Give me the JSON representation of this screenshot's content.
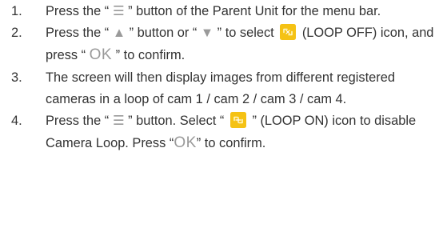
{
  "steps": [
    {
      "number": "1.",
      "parts": [
        "Press the “ ",
        "☰",
        " ” button of the Parent Unit for the menu bar."
      ]
    },
    {
      "number": "2.",
      "parts": [
        "Press the “ ",
        "▲",
        " ” button or “ ",
        "▼",
        " ” to select ",
        "loop-off-icon",
        " (LOOP OFF) icon, and press “ ",
        "OK",
        " ” to confirm."
      ]
    },
    {
      "number": "3.",
      "parts": [
        "The screen will then display images from different registered cameras in a loop of cam 1 / cam 2 / cam 3 / cam 4."
      ]
    },
    {
      "number": "4.",
      "parts": [
        "Press the “ ",
        "☰",
        " ” button. Select “ ",
        "loop-on-icon",
        " ” (LOOP ON) icon to disable Camera Loop. Press “",
        "OK",
        "” to confirm."
      ]
    }
  ],
  "icons": {
    "menu": "menu-icon",
    "up": "up-arrow-icon",
    "down": "down-arrow-icon",
    "loop": "loop-icon",
    "ok": "ok-icon"
  },
  "colors": {
    "text": "#333333",
    "glyph": "#9a9a9a",
    "icon_fill": "#f5c214",
    "icon_mark": "#ffffff"
  }
}
